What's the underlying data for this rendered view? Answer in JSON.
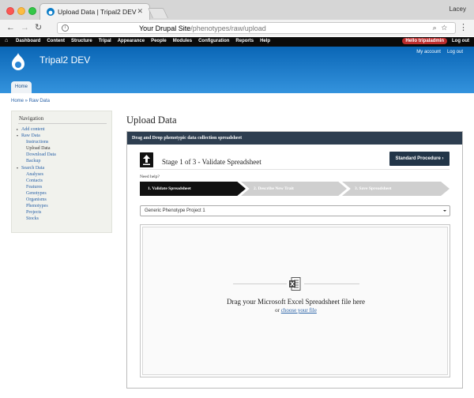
{
  "browser": {
    "tab_title": "Upload Data | Tripal2 DEV",
    "profile": "Lacey",
    "url_host": "Your Drupal Site",
    "url_path": "/phenotypes/raw/upload"
  },
  "admin_bar": {
    "home_icon": "home-icon",
    "items": [
      "Dashboard",
      "Content",
      "Structure",
      "Tripal",
      "Appearance",
      "People",
      "Modules",
      "Configuration",
      "Reports",
      "Help"
    ],
    "hello": "Hello tripaladmin",
    "logout": "Log out"
  },
  "header": {
    "site_name": "Tripal2 DEV",
    "my_account": "My account",
    "logout": "Log out",
    "tab_home": "Home"
  },
  "breadcrumb": "Home » Raw Data",
  "sidebar": {
    "title": "Navigation",
    "items": [
      {
        "label": "Add content",
        "level": 1,
        "open": false
      },
      {
        "label": "Raw Data",
        "level": 1,
        "open": true
      },
      {
        "label": "Instructions",
        "level": 2
      },
      {
        "label": "Upload Data",
        "level": 2,
        "active": true
      },
      {
        "label": "Download Data",
        "level": 2
      },
      {
        "label": "Backup",
        "level": 2
      },
      {
        "label": "Search Data",
        "level": 1,
        "open": true
      },
      {
        "label": "Analyses",
        "level": 2
      },
      {
        "label": "Contacts",
        "level": 2
      },
      {
        "label": "Features",
        "level": 2
      },
      {
        "label": "Genotypes",
        "level": 2
      },
      {
        "label": "Organisms",
        "level": 2
      },
      {
        "label": "Phenotypes",
        "level": 2
      },
      {
        "label": "Projects",
        "level": 2
      },
      {
        "label": "Stocks",
        "level": 2
      }
    ]
  },
  "main": {
    "page_title": "Upload Data",
    "panel_title": "Drag and Drop phenotypic data collection spreadsheet",
    "stage_title": "Stage 1 of 3 - Validate Spreadsheet",
    "standard_procedure": "Standard Procedure ›",
    "need_help": "Need help?",
    "steps": [
      "1. Validate Spreadsheet",
      "2. Describe New Trait",
      "3. Save Spreadsheet"
    ],
    "project_select": "Generic Phenotype Project 1",
    "drop_text": "Drag your Microsoft Excel Spreadsheet file here",
    "or_text": "or",
    "choose_file": "choose your file"
  }
}
